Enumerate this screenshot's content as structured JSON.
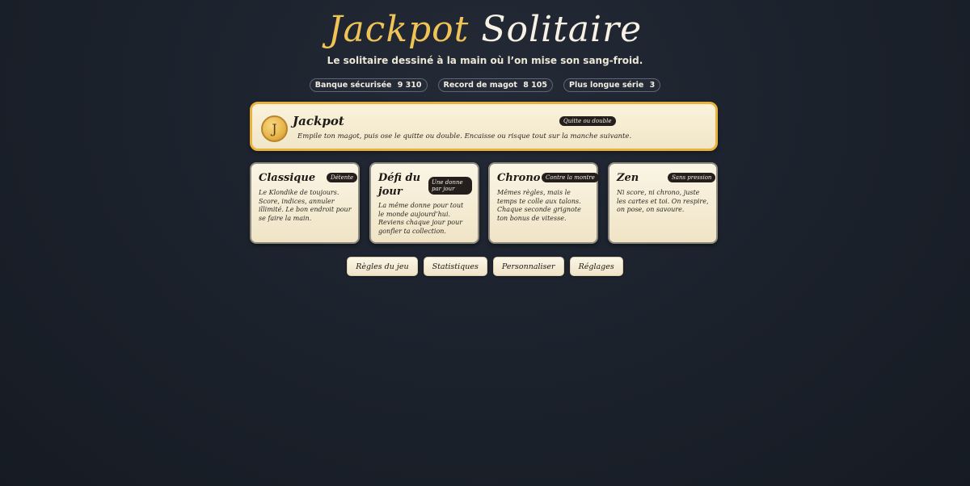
{
  "header": {
    "title_part1": "Jackpot",
    "title_part2": "Solitaire",
    "subtitle": "Le solitaire dessiné à la main où l’on mise son sang-froid."
  },
  "stats": [
    {
      "label": "Banque sécurisée",
      "value": "9 310"
    },
    {
      "label": "Record de magot",
      "value": "8 105"
    },
    {
      "label": "Plus longue série",
      "value": "3"
    }
  ],
  "jackpot": {
    "coin_letter": "J",
    "title": "Jackpot",
    "badge": "Quitte ou double",
    "description": "Empile ton magot, puis ose le quitte ou double. Encaisse ou risque tout sur la manche suivante."
  },
  "modes": [
    {
      "name": "Classique",
      "badge": "Détente",
      "description": "Le Klondike de toujours. Score, indices, annuler illimité. Le bon endroit pour se faire la main."
    },
    {
      "name": "Défi du jour",
      "badge": "Une donne par jour",
      "description": "La même donne pour tout le monde aujourd’hui. Reviens chaque jour pour gonfler ta collection."
    },
    {
      "name": "Chrono",
      "badge": "Contre la montre",
      "description": "Mêmes règles, mais le temps te colle aux talons. Chaque seconde grignote ton bonus de vitesse."
    },
    {
      "name": "Zen",
      "badge": "Sans pression",
      "description": "Ni score, ni chrono, juste les cartes et toi. On respire, on pose, on savoure."
    }
  ],
  "actions": [
    {
      "label": "Règles du jeu"
    },
    {
      "label": "Statistiques"
    },
    {
      "label": "Personnaliser"
    },
    {
      "label": "Réglages"
    }
  ],
  "colors": {
    "background": "#1b212b",
    "gold_accent": "#efc355",
    "jackpot_border": "#e9b13d",
    "card_bg": "#f7eed6",
    "badge_bg": "#241f1c"
  }
}
